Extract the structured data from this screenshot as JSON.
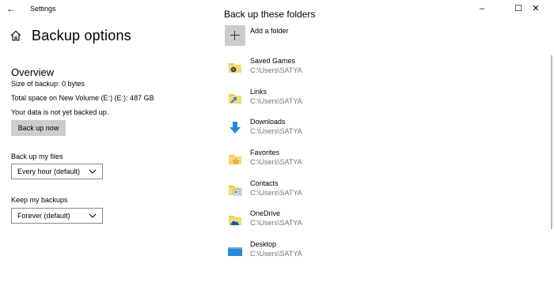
{
  "window": {
    "app_title": "Settings",
    "back_glyph": "←",
    "minimize_glyph": "–",
    "maximize_glyph": "☐",
    "close_glyph": "✕"
  },
  "page": {
    "title": "Backup options",
    "home_icon": "home-icon"
  },
  "overview": {
    "heading": "Overview",
    "size_of_backup": "Size of backup: 0 bytes",
    "total_space": "Total space on New Volume (E:) (E:): 487 GB",
    "status": "Your data is not yet backed up.",
    "backup_button": "Back up now"
  },
  "settings": {
    "frequency_label": "Back up my files",
    "frequency_value": "Every hour (default)",
    "retention_label": "Keep my backups",
    "retention_value": "Forever (default)"
  },
  "folders": {
    "heading": "Back up these folders",
    "add_label": "Add a folder",
    "items": [
      {
        "name": "Saved Games",
        "path": "C:\\Users\\SATYA",
        "icon": "saved-games-folder-icon"
      },
      {
        "name": "Links",
        "path": "C:\\Users\\SATYA",
        "icon": "links-folder-icon"
      },
      {
        "name": "Downloads",
        "path": "C:\\Users\\SATYA",
        "icon": "downloads-folder-icon"
      },
      {
        "name": "Favorites",
        "path": "C:\\Users\\SATYA",
        "icon": "favorites-folder-icon"
      },
      {
        "name": "Contacts",
        "path": "C:\\Users\\SATYA",
        "icon": "contacts-folder-icon"
      },
      {
        "name": "OneDrive",
        "path": "C:\\Users\\SATYA",
        "icon": "onedrive-folder-icon"
      },
      {
        "name": "Desktop",
        "path": "C:\\Users\\SATYA",
        "icon": "desktop-folder-icon"
      }
    ]
  },
  "colors": {
    "button_bg": "#cccccc",
    "secondary_text": "#767676",
    "folder_yellow": "#f3c65c",
    "accent_blue": "#2b88d8"
  }
}
